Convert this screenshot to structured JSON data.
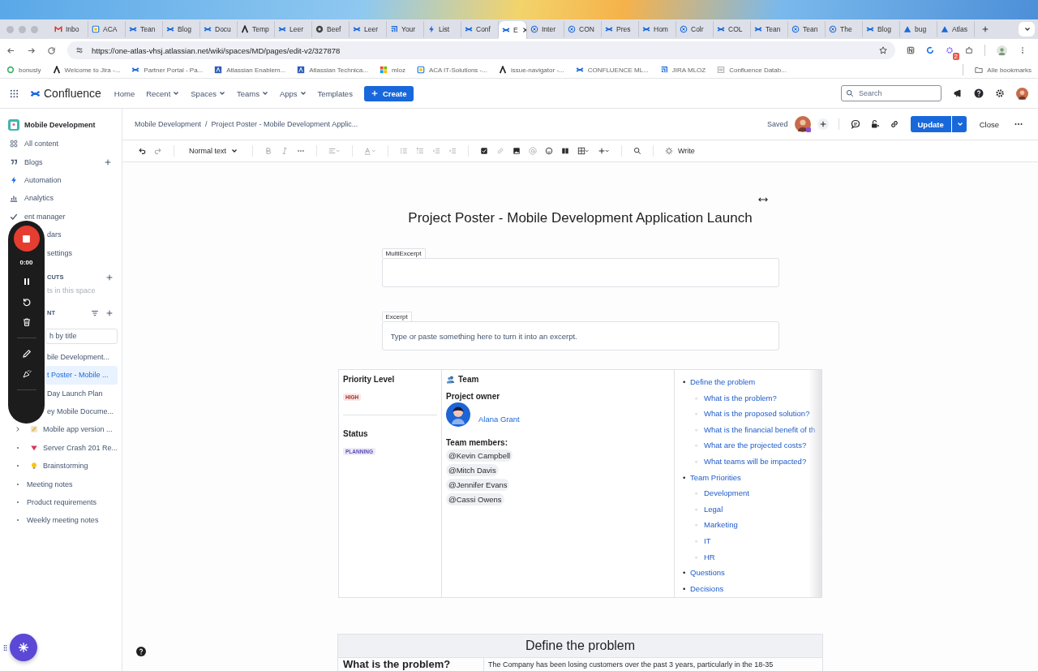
{
  "browser": {
    "tabs": [
      {
        "label": "Inbo",
        "kind": "gmail",
        "selected": false
      },
      {
        "label": "ACA",
        "kind": "calendar",
        "selected": false
      },
      {
        "label": "Tean",
        "kind": "confluence",
        "selected": false
      },
      {
        "label": "Blog",
        "kind": "confluence",
        "selected": false
      },
      {
        "label": "Docu",
        "kind": "confluence",
        "selected": false
      },
      {
        "label": "Temp",
        "kind": "atlassian",
        "selected": false
      },
      {
        "label": "Leer",
        "kind": "confluence",
        "selected": false
      },
      {
        "label": "Beef",
        "kind": "globe",
        "selected": false
      },
      {
        "label": "Leer",
        "kind": "confluence",
        "selected": false
      },
      {
        "label": "Your",
        "kind": "jira",
        "selected": false
      },
      {
        "label": "List",
        "kind": "bolt",
        "selected": false
      },
      {
        "label": "Conf",
        "kind": "confluence",
        "selected": false
      },
      {
        "label": "E",
        "kind": "confluence",
        "selected": true
      },
      {
        "label": "Inter",
        "kind": "loop",
        "selected": false
      },
      {
        "label": "CON",
        "kind": "loop",
        "selected": false
      },
      {
        "label": "Pres",
        "kind": "confluence",
        "selected": false
      },
      {
        "label": "Hom",
        "kind": "confluence",
        "selected": false
      },
      {
        "label": "Colr",
        "kind": "loop",
        "selected": false
      },
      {
        "label": "COL",
        "kind": "confluence",
        "selected": false
      },
      {
        "label": "Tean",
        "kind": "confluence",
        "selected": false
      },
      {
        "label": "Tean",
        "kind": "loop",
        "selected": false
      },
      {
        "label": "The",
        "kind": "loop",
        "selected": false
      },
      {
        "label": "Blog",
        "kind": "confluence",
        "selected": false
      },
      {
        "label": "bug",
        "kind": "triangle",
        "selected": false
      },
      {
        "label": "Atlas",
        "kind": "triangle",
        "selected": false
      }
    ],
    "url": "https://one-atlas-vhsj.atlassian.net/wiki/spaces/MD/pages/edit-v2/327878",
    "extension_badge": "2",
    "bookmarks": [
      {
        "label": "bonusly",
        "kind": "ring"
      },
      {
        "label": "Welcome to Jira -...",
        "kind": "atlassian"
      },
      {
        "label": "Partner Portal - Pa...",
        "kind": "confluence"
      },
      {
        "label": "Atlassian Enablem...",
        "kind": "box"
      },
      {
        "label": "Atlassian Technica...",
        "kind": "box"
      },
      {
        "label": "mloz",
        "kind": "squares"
      },
      {
        "label": "ACA IT-Solutions -...",
        "kind": "calendar"
      },
      {
        "label": "issue-navigator -...",
        "kind": "atlassian"
      },
      {
        "label": "CONFLUENCE ML...",
        "kind": "confluence"
      },
      {
        "label": "JIRA MLOZ",
        "kind": "jira"
      },
      {
        "label": "Confluence Datab...",
        "kind": "doc"
      }
    ],
    "all_bookmarks": "Alle bookmarks"
  },
  "nav": {
    "product": "Confluence",
    "items": [
      {
        "label": "Home",
        "dropdown": false
      },
      {
        "label": "Recent",
        "dropdown": true
      },
      {
        "label": "Spaces",
        "dropdown": true
      },
      {
        "label": "Teams",
        "dropdown": true
      },
      {
        "label": "Apps",
        "dropdown": true
      },
      {
        "label": "Templates",
        "dropdown": false
      }
    ],
    "create": "Create",
    "search": {
      "placeholder": "Search"
    }
  },
  "sidebar": {
    "space": "Mobile Development",
    "items": [
      {
        "label": "All content",
        "kind": "grid",
        "add": false
      },
      {
        "label": "Blogs",
        "kind": "quote",
        "add": true
      },
      {
        "label": "Automation",
        "kind": "bolt",
        "add": false
      },
      {
        "label": "Analytics",
        "kind": "chart",
        "add": false
      },
      {
        "label": "ent manager",
        "kind": "check",
        "add": false
      },
      {
        "label": "dars",
        "kind": "plain",
        "add": false
      },
      {
        "label": "settings",
        "kind": "plain",
        "add": false
      }
    ],
    "shortcuts": {
      "heading": "CUTS",
      "empty": "ts in this space"
    },
    "content": {
      "heading": "NT",
      "search": {
        "placeholder": "h by title"
      },
      "pages": [
        {
          "label": "bile Development...",
          "kind": "plain",
          "selected": false
        },
        {
          "label": "t Poster - Mobile ...",
          "kind": "plain",
          "selected": true
        },
        {
          "label": "Day Launch Plan",
          "kind": "plain",
          "selected": false
        },
        {
          "label": "ey Mobile Docume...",
          "kind": "plain",
          "selected": false
        },
        {
          "label": "Mobile app version ...",
          "kind": "folder",
          "selected": false
        },
        {
          "label": "Server Crash 201 Re...",
          "kind": "incident",
          "selected": false
        },
        {
          "label": "Brainstorming",
          "kind": "idea",
          "selected": false
        },
        {
          "label": "Meeting notes",
          "kind": "note",
          "selected": false
        },
        {
          "label": "Product requirements",
          "kind": "note",
          "selected": false
        },
        {
          "label": "Weekly meeting notes",
          "kind": "note",
          "selected": false
        }
      ]
    }
  },
  "recorder": {
    "time": "0:00"
  },
  "header": {
    "breadcrumbs": [
      "Mobile Development",
      "Project Poster - Mobile Development Applic..."
    ],
    "separator": "/",
    "saved": "Saved",
    "update": "Update",
    "close": "Close"
  },
  "toolbar": {
    "style": "Normal text",
    "write": "Write"
  },
  "page": {
    "title": "Project Poster - Mobile Development Application Launch",
    "multi_excerpt": {
      "label": "MultiExcerpt"
    },
    "excerpt": {
      "label": "Excerpt",
      "placeholder": "Type or paste something here to turn it into an excerpt."
    },
    "poster": {
      "priority": {
        "heading": "Priority Level",
        "lozenge": "HIGH",
        "color": "#ae2e24"
      },
      "status": {
        "heading": "Status",
        "lozenge": "PLANNING",
        "color": "#5e4db2"
      },
      "team": {
        "heading": "Team",
        "owner_label": "Project owner",
        "owner": "Alana Grant",
        "members_label": "Team members:",
        "members": [
          "@Kevin Campbell",
          "@Mitch Davis",
          "@Jennifer Evans",
          "@Cassi Owens"
        ]
      },
      "toc_bullets": [
        "•",
        "◦"
      ],
      "toc": [
        {
          "label": "Define the problem",
          "children": [
            {
              "label": "What is the problem?"
            },
            {
              "label": "What is the proposed solution?"
            },
            {
              "label": "What is the financial benefit of th"
            },
            {
              "label": "What are the projected costs?"
            },
            {
              "label": "What teams will be impacted?"
            }
          ]
        },
        {
          "label": "Team Priorities",
          "children": [
            {
              "label": "Development"
            },
            {
              "label": "Legal"
            },
            {
              "label": "Marketing"
            },
            {
              "label": "IT"
            },
            {
              "label": "HR"
            }
          ]
        },
        {
          "label": "Questions"
        },
        {
          "label": "Decisions"
        }
      ]
    },
    "section": {
      "heading": "Define the problem",
      "row_label": "What is the problem?",
      "row_text": "The Company has been losing customers over the past 3 years, particularly in the 18-35"
    }
  }
}
